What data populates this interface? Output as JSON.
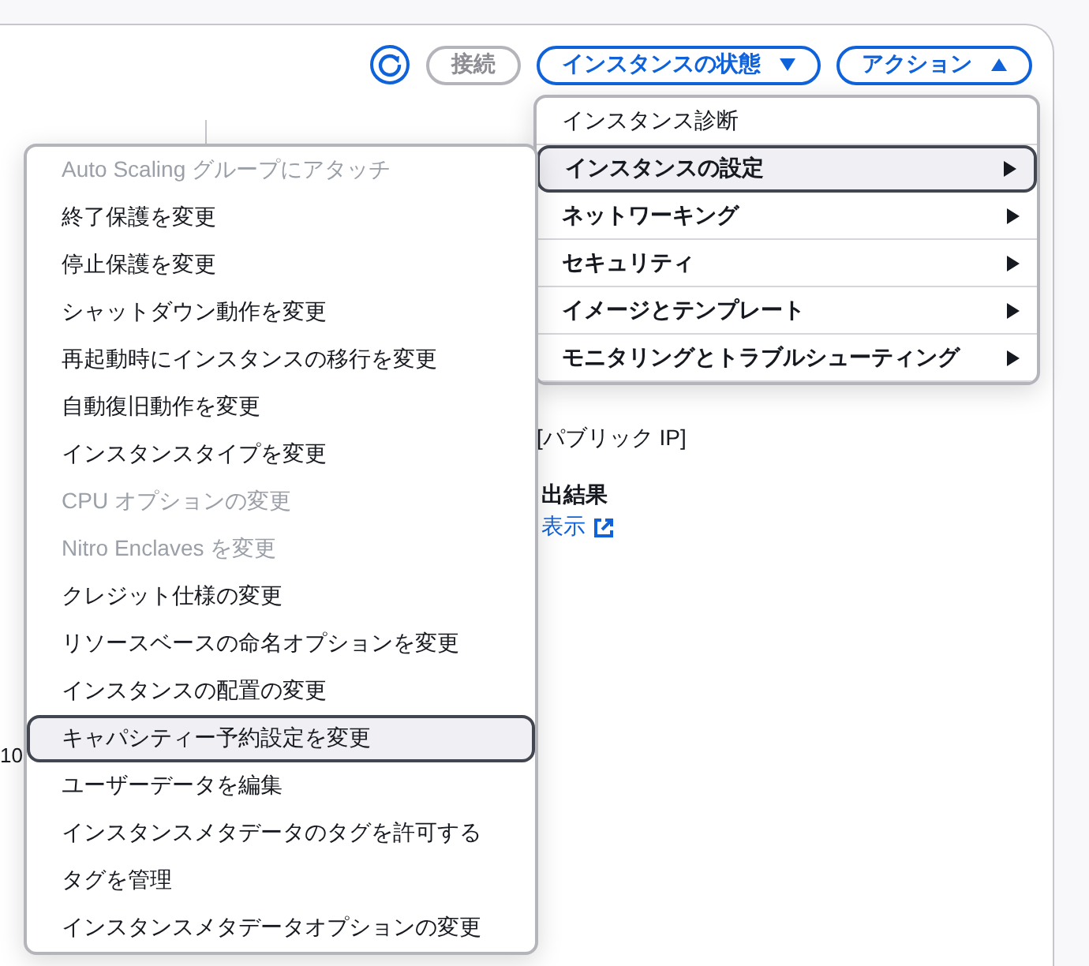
{
  "toolbar": {
    "connect": {
      "label": "接続",
      "disabled": true
    },
    "instance_state": {
      "label": "インスタンスの状態",
      "expanded": false
    },
    "actions": {
      "label": "アクション",
      "expanded": true
    }
  },
  "actions_menu": [
    {
      "label": "インスタンス診断",
      "kind": "action",
      "selected": false
    },
    {
      "label": "インスタンスの設定",
      "kind": "submenu",
      "selected": true
    },
    {
      "label": "ネットワーキング",
      "kind": "submenu",
      "selected": false
    },
    {
      "label": "セキュリティ",
      "kind": "submenu",
      "selected": false
    },
    {
      "label": "イメージとテンプレート",
      "kind": "submenu",
      "selected": false
    },
    {
      "label": "モニタリングとトラブルシューティング",
      "kind": "submenu",
      "selected": false
    }
  ],
  "settings_submenu": [
    {
      "label": "Auto Scaling グループにアタッチ",
      "disabled": true,
      "selected": false
    },
    {
      "label": "終了保護を変更",
      "disabled": false,
      "selected": false
    },
    {
      "label": "停止保護を変更",
      "disabled": false,
      "selected": false
    },
    {
      "label": "シャットダウン動作を変更",
      "disabled": false,
      "selected": false
    },
    {
      "label": "再起動時にインスタンスの移行を変更",
      "disabled": false,
      "selected": false
    },
    {
      "label": "自動復旧動作を変更",
      "disabled": false,
      "selected": false
    },
    {
      "label": "インスタンスタイプを変更",
      "disabled": false,
      "selected": false
    },
    {
      "label": "CPU オプションの変更",
      "disabled": true,
      "selected": false
    },
    {
      "label": "Nitro Enclaves を変更",
      "disabled": true,
      "selected": false
    },
    {
      "label": "クレジット仕様の変更",
      "disabled": false,
      "selected": false
    },
    {
      "label": "リソースベースの命名オプションを変更",
      "disabled": false,
      "selected": false
    },
    {
      "label": "インスタンスの配置の変更",
      "disabled": false,
      "selected": false
    },
    {
      "label": "キャパシティー予約設定を変更",
      "disabled": false,
      "selected": true
    },
    {
      "label": "ユーザーデータを編集",
      "disabled": false,
      "selected": false
    },
    {
      "label": "インスタンスメタデータのタグを許可する",
      "disabled": false,
      "selected": false
    },
    {
      "label": "タグを管理",
      "disabled": false,
      "selected": false
    },
    {
      "label": "インスタンスメタデータオプションの変更",
      "disabled": false,
      "selected": false
    }
  ],
  "background": {
    "row_value": "10",
    "public_ip_label": "[パブリック IP]",
    "heading": "出結果",
    "link": "表示"
  }
}
